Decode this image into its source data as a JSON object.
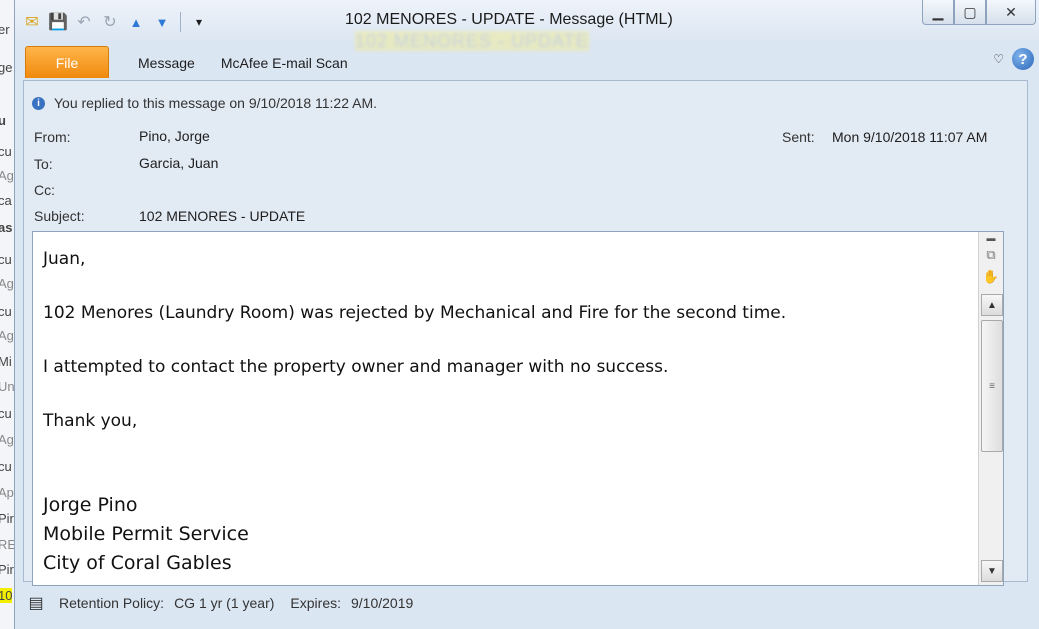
{
  "background_window": {
    "fragments": [
      "er",
      "ge",
      "u",
      "cu",
      "Ag",
      "ca",
      "as",
      "cu",
      "Ag",
      "cu",
      "Ag",
      "Mi",
      "Un",
      "cu",
      "Ag",
      "cu",
      "Ap",
      "Pir",
      "RE",
      "Pir",
      "10"
    ]
  },
  "window": {
    "title": "102 MENORES - UPDATE  -  Message (HTML)",
    "blurred_title": "102 MENORES - UPDATE",
    "minimize_glyph": "▁",
    "maximize_glyph": "▢",
    "close_glyph": "✕"
  },
  "quick_access": {
    "mail_icon": "✉",
    "save_icon": "💾",
    "undo_icon": "↶",
    "redo_icon": "↻",
    "prev_icon": "▲",
    "next_icon": "▼",
    "customize_icon": "▾"
  },
  "ribbon": {
    "tabs": [
      "File",
      "Message",
      "McAfee E-mail Scan"
    ],
    "help_glyph": "?",
    "minimize_ribbon_glyph": "♡"
  },
  "info_bar": {
    "icon": "i",
    "text": "You replied to this message on 9/10/2018 11:22 AM."
  },
  "header": {
    "from_label": "From:",
    "from_value": "Pino, Jorge",
    "to_label": "To:",
    "to_value": "Garcia, Juan",
    "cc_label": "Cc:",
    "cc_value": "",
    "subject_label": "Subject:",
    "subject_value": "102 MENORES - UPDATE",
    "sent_label": "Sent:",
    "sent_value": "Mon 9/10/2018 11:07 AM"
  },
  "body": {
    "greeting": "Juan,",
    "para1": "102 Menores (Laundry Room) was rejected by Mechanical and Fire for the second time.",
    "para2": "I attempted to contact the property owner and manager with no success.",
    "closing": "Thank you,",
    "sig_name": "Jorge Pino",
    "sig_title": "Mobile Permit Service",
    "sig_org": "City of Coral Gables"
  },
  "scrollbar": {
    "up_glyph": "▲",
    "down_glyph": "▼",
    "grip_glyph": "≡",
    "side_icon1": "▬",
    "side_icon2": "⧉",
    "side_icon3": "✋"
  },
  "footer": {
    "shredder_icon": "▤",
    "retention_label": "Retention Policy:",
    "retention_value": "CG 1 yr (1 year)",
    "expires_label": "Expires:",
    "expires_value": "9/10/2019"
  }
}
